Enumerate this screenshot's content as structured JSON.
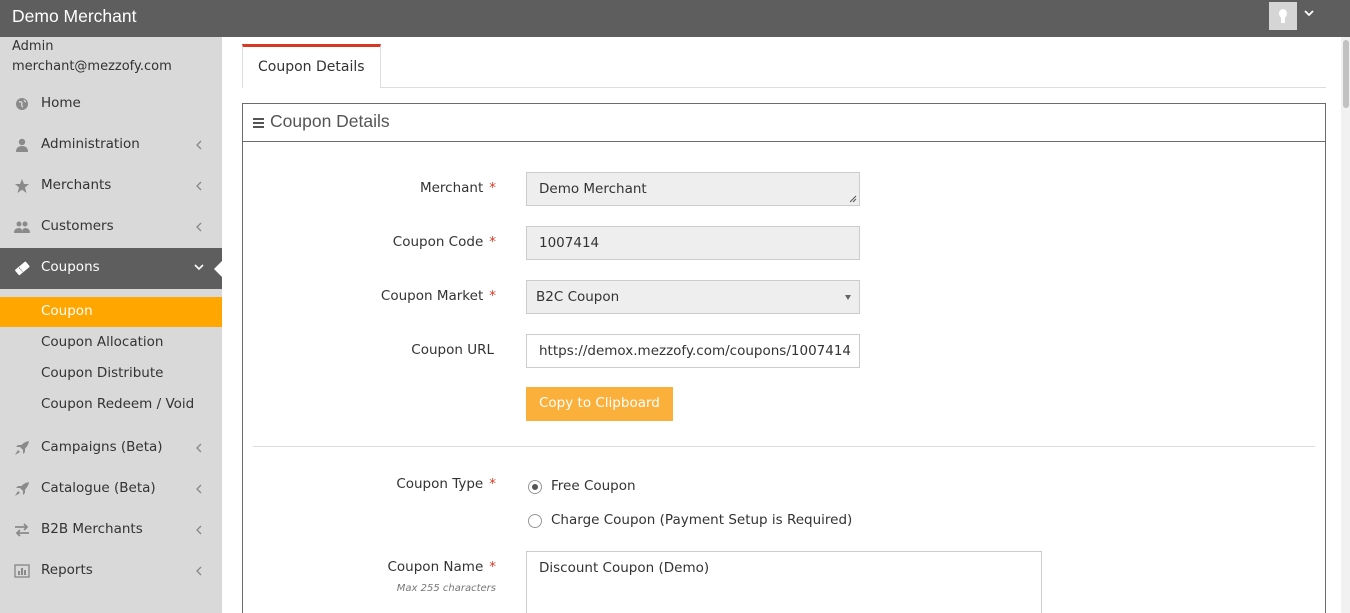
{
  "header": {
    "brand": "Demo Merchant",
    "user_icon": "user-icon",
    "dropdown_icon": "chevron-down-icon"
  },
  "sidebar": {
    "user_role": "Admin",
    "user_email": "merchant@mezzofy.com",
    "items": [
      {
        "label": "Home",
        "icon": "globe-icon"
      },
      {
        "label": "Administration",
        "icon": "user-icon"
      },
      {
        "label": "Merchants",
        "icon": "star-icon"
      },
      {
        "label": "Customers",
        "icon": "users-icon"
      },
      {
        "label": "Coupons",
        "icon": "ticket-icon"
      },
      {
        "label": "Campaigns (Beta)",
        "icon": "rocket-icon"
      },
      {
        "label": "Catalogue (Beta)",
        "icon": "rocket-icon"
      },
      {
        "label": "B2B Merchants",
        "icon": "exchange-icon"
      },
      {
        "label": "Reports",
        "icon": "bar-chart-icon"
      }
    ],
    "sub_items": [
      {
        "label": "Coupon"
      },
      {
        "label": "Coupon Allocation"
      },
      {
        "label": "Coupon Distribute"
      },
      {
        "label": "Coupon Redeem / Void"
      }
    ],
    "active_color": "#ffa600"
  },
  "tabs": [
    {
      "label": "Coupon Details"
    }
  ],
  "panel": {
    "title": "Coupon Details",
    "fields": {
      "merchant": {
        "label": "Merchant",
        "value": "Demo Merchant"
      },
      "coupon_code": {
        "label": "Coupon Code",
        "value": "1007414"
      },
      "coupon_market": {
        "label": "Coupon Market",
        "value": "B2C Coupon"
      },
      "coupon_url": {
        "label": "Coupon URL",
        "value": "https://demox.mezzofy.com/coupons/1007414"
      },
      "copy_button": "Copy to Clipboard",
      "coupon_type": {
        "label": "Coupon Type",
        "options": [
          "Free Coupon",
          "Charge Coupon (Payment Setup is Required)"
        ],
        "selected": "Free Coupon"
      },
      "coupon_name": {
        "label": "Coupon Name",
        "hint": "Max 255 characters",
        "value": "Discount Coupon (Demo)"
      }
    },
    "required_mark": "*",
    "required_color": "#d73925",
    "button_color": "#fbb03b"
  }
}
